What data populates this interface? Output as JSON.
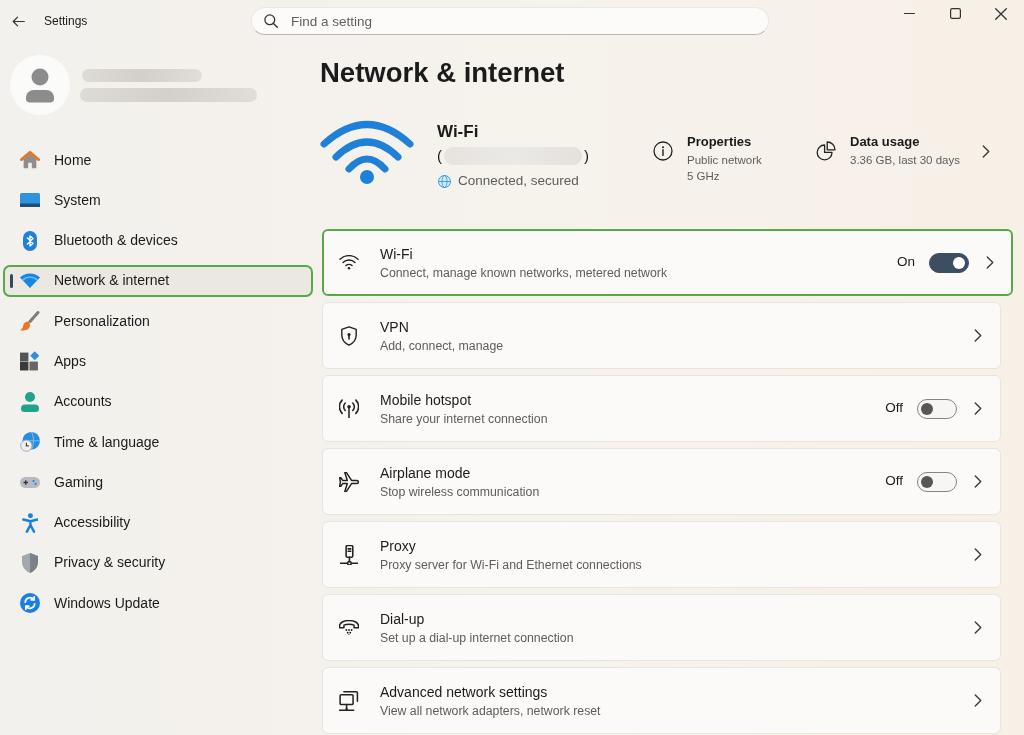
{
  "window": {
    "title": "Settings"
  },
  "search": {
    "placeholder": "Find a setting"
  },
  "sidebar": {
    "items": [
      {
        "label": "Home",
        "selected": false,
        "highlighted": false
      },
      {
        "label": "System",
        "selected": false,
        "highlighted": false
      },
      {
        "label": "Bluetooth & devices",
        "selected": false,
        "highlighted": false
      },
      {
        "label": "Network & internet",
        "selected": true,
        "highlighted": true
      },
      {
        "label": "Personalization",
        "selected": false,
        "highlighted": false
      },
      {
        "label": "Apps",
        "selected": false,
        "highlighted": false
      },
      {
        "label": "Accounts",
        "selected": false,
        "highlighted": false
      },
      {
        "label": "Time & language",
        "selected": false,
        "highlighted": false
      },
      {
        "label": "Gaming",
        "selected": false,
        "highlighted": false
      },
      {
        "label": "Accessibility",
        "selected": false,
        "highlighted": false
      },
      {
        "label": "Privacy & security",
        "selected": false,
        "highlighted": false
      },
      {
        "label": "Windows Update",
        "selected": false,
        "highlighted": false
      }
    ]
  },
  "page_title": "Network & internet",
  "connection": {
    "name": "Wi-Fi",
    "network_name_open": "(",
    "network_name_close": ")",
    "status": "Connected, secured"
  },
  "properties": {
    "title": "Properties",
    "lines": [
      "Public network",
      "5 GHz"
    ]
  },
  "data_usage": {
    "title": "Data usage",
    "detail": "3.36 GB, last 30 days"
  },
  "settings": [
    {
      "kind": "toggle",
      "title": "Wi-Fi",
      "subtitle": "Connect, manage known networks, metered network",
      "state_label": "On",
      "on": true,
      "highlighted": true
    },
    {
      "kind": "link",
      "title": "VPN",
      "subtitle": "Add, connect, manage",
      "highlighted": false
    },
    {
      "kind": "toggle",
      "title": "Mobile hotspot",
      "subtitle": "Share your internet connection",
      "state_label": "Off",
      "on": false,
      "highlighted": false
    },
    {
      "kind": "toggle",
      "title": "Airplane mode",
      "subtitle": "Stop wireless communication",
      "state_label": "Off",
      "on": false,
      "highlighted": false
    },
    {
      "kind": "link",
      "title": "Proxy",
      "subtitle": "Proxy server for Wi-Fi and Ethernet connections",
      "highlighted": false
    },
    {
      "kind": "link",
      "title": "Dial-up",
      "subtitle": "Set up a dial-up internet connection",
      "highlighted": false
    },
    {
      "kind": "link",
      "title": "Advanced network settings",
      "subtitle": "View all network adapters, network reset",
      "highlighted": false
    }
  ]
}
